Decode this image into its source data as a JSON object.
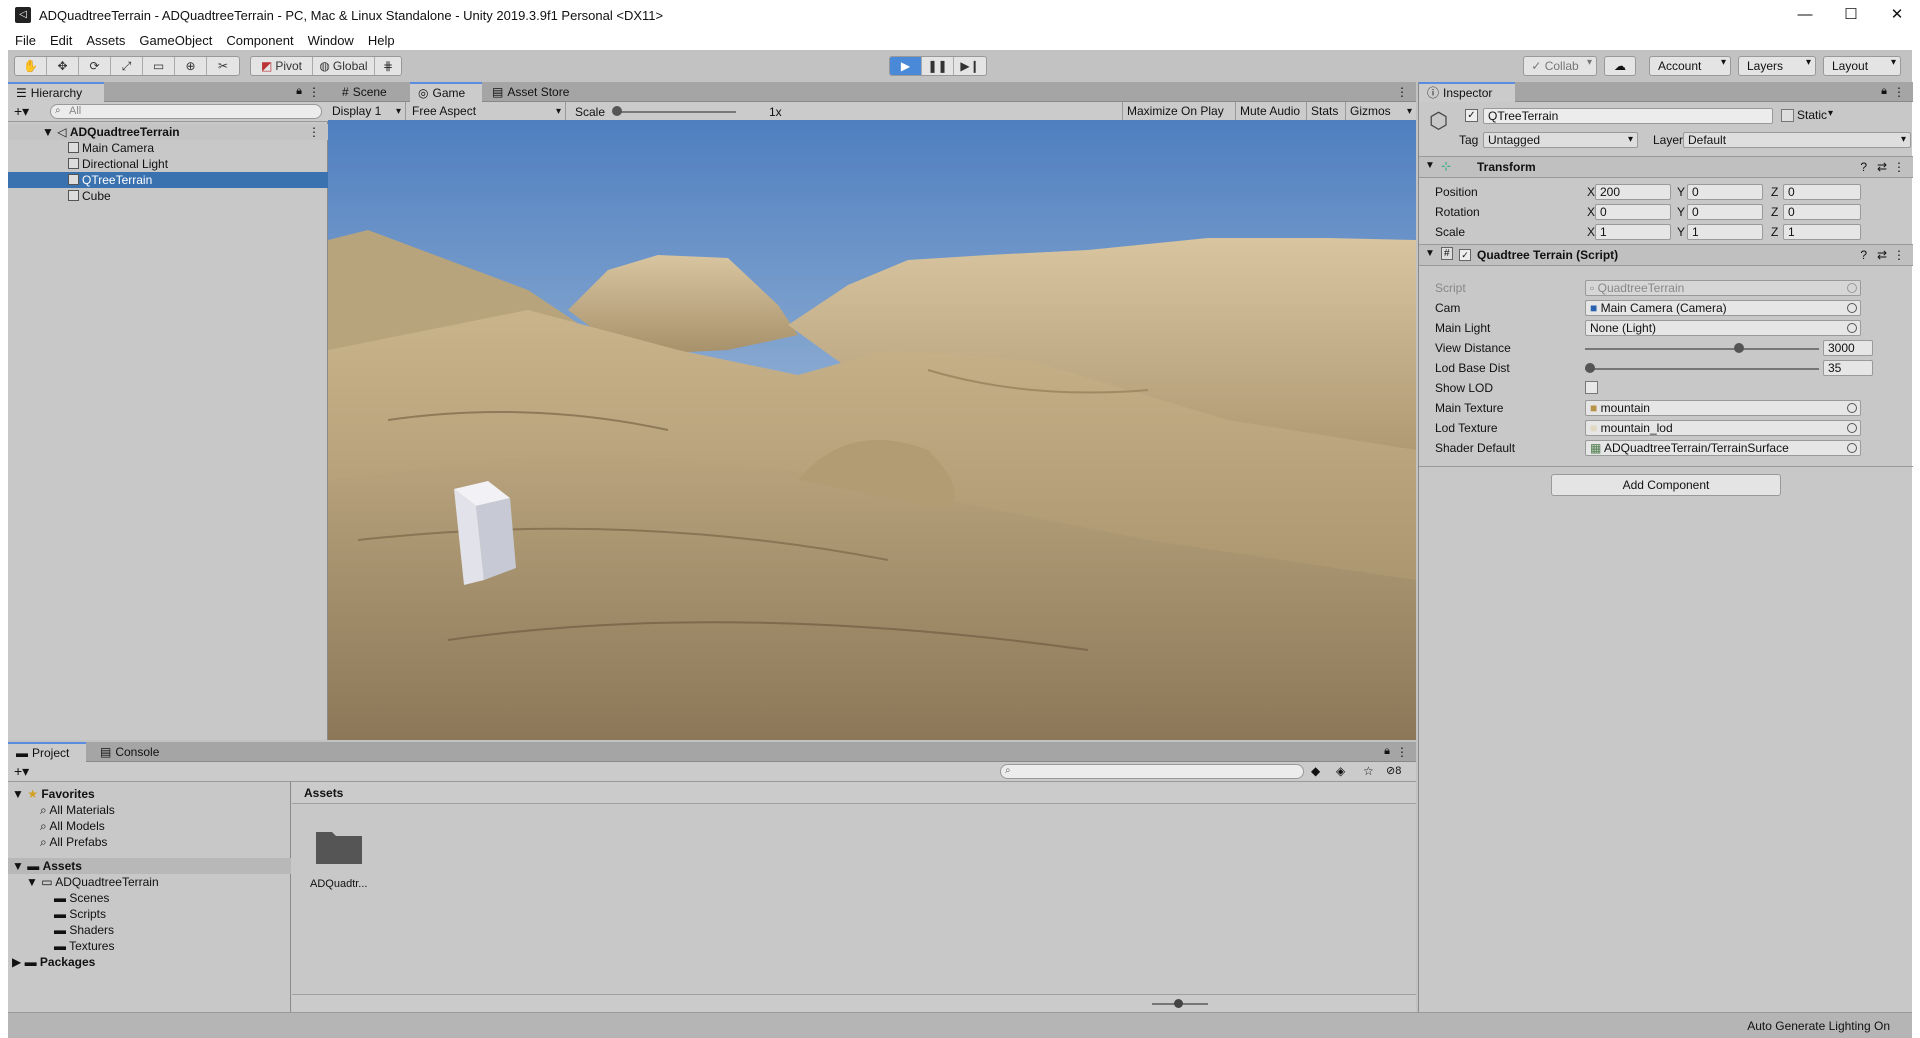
{
  "window": {
    "title": "ADQuadtreeTerrain - ADQuadtreeTerrain - PC, Mac & Linux Standalone - Unity 2019.3.9f1 Personal <DX11>",
    "minimize": "—",
    "maximize": "☐",
    "close": "✕"
  },
  "menu": [
    "File",
    "Edit",
    "Assets",
    "GameObject",
    "Component",
    "Window",
    "Help"
  ],
  "toolbar": {
    "pivot": "Pivot",
    "global": "Global",
    "collab": "Collab",
    "account": "Account",
    "layers": "Layers",
    "layout": "Layout"
  },
  "hierarchy": {
    "tab": "Hierarchy",
    "search_placeholder": "All",
    "scene": "ADQuadtreeTerrain",
    "items": [
      "Main Camera",
      "Directional Light",
      "QTreeTerrain",
      "Cube"
    ],
    "selected": "QTreeTerrain"
  },
  "center": {
    "tabs": [
      "Scene",
      "Game",
      "Asset Store"
    ],
    "active_tab": "Game",
    "display": "Display 1",
    "aspect": "Free Aspect",
    "scale_label": "Scale",
    "scale_value": "1x",
    "maximize": "Maximize On Play",
    "mute": "Mute Audio",
    "stats": "Stats",
    "gizmos": "Gizmos"
  },
  "inspector": {
    "tab": "Inspector",
    "object_name": "QTreeTerrain",
    "static": "Static",
    "tag_label": "Tag",
    "tag": "Untagged",
    "layer_label": "Layer",
    "layer": "Default",
    "transform": {
      "title": "Transform",
      "position": {
        "label": "Position",
        "x": "200",
        "y": "0",
        "z": "0"
      },
      "rotation": {
        "label": "Rotation",
        "x": "0",
        "y": "0",
        "z": "0"
      },
      "scale": {
        "label": "Scale",
        "x": "1",
        "y": "1",
        "z": "1"
      }
    },
    "script_component": {
      "title": "Quadtree Terrain (Script)",
      "script_label": "Script",
      "script": "QuadtreeTerrain",
      "cam_label": "Cam",
      "cam": "Main Camera (Camera)",
      "main_light_label": "Main Light",
      "main_light": "None (Light)",
      "view_distance_label": "View Distance",
      "view_distance": "3000",
      "view_distance_fraction": 0.66,
      "lod_base_dist_label": "Lod Base Dist",
      "lod_base_dist": "35",
      "lod_base_dist_fraction": 0.0,
      "show_lod_label": "Show LOD",
      "main_texture_label": "Main Texture",
      "main_texture": "mountain",
      "lod_texture_label": "Lod Texture",
      "lod_texture": "mountain_lod",
      "shader_label": "Shader Default",
      "shader": "ADQuadtreeTerrain/TerrainSurface"
    },
    "add_component": "Add Component"
  },
  "project": {
    "tabs": [
      "Project",
      "Console"
    ],
    "favorites": "Favorites",
    "fav_items": [
      "All Materials",
      "All Models",
      "All Prefabs"
    ],
    "assets": "Assets",
    "asset_root": "ADQuadtreeTerrain",
    "asset_children": [
      "Scenes",
      "Scripts",
      "Shaders",
      "Textures"
    ],
    "packages": "Packages",
    "breadcrumb": "Assets",
    "folder_label": "ADQuadtr...",
    "hidden_count": "8"
  },
  "status": {
    "text": "Auto Generate Lighting On"
  },
  "colors": {
    "accent": "#3a72b0",
    "play": "#4a88d8"
  }
}
